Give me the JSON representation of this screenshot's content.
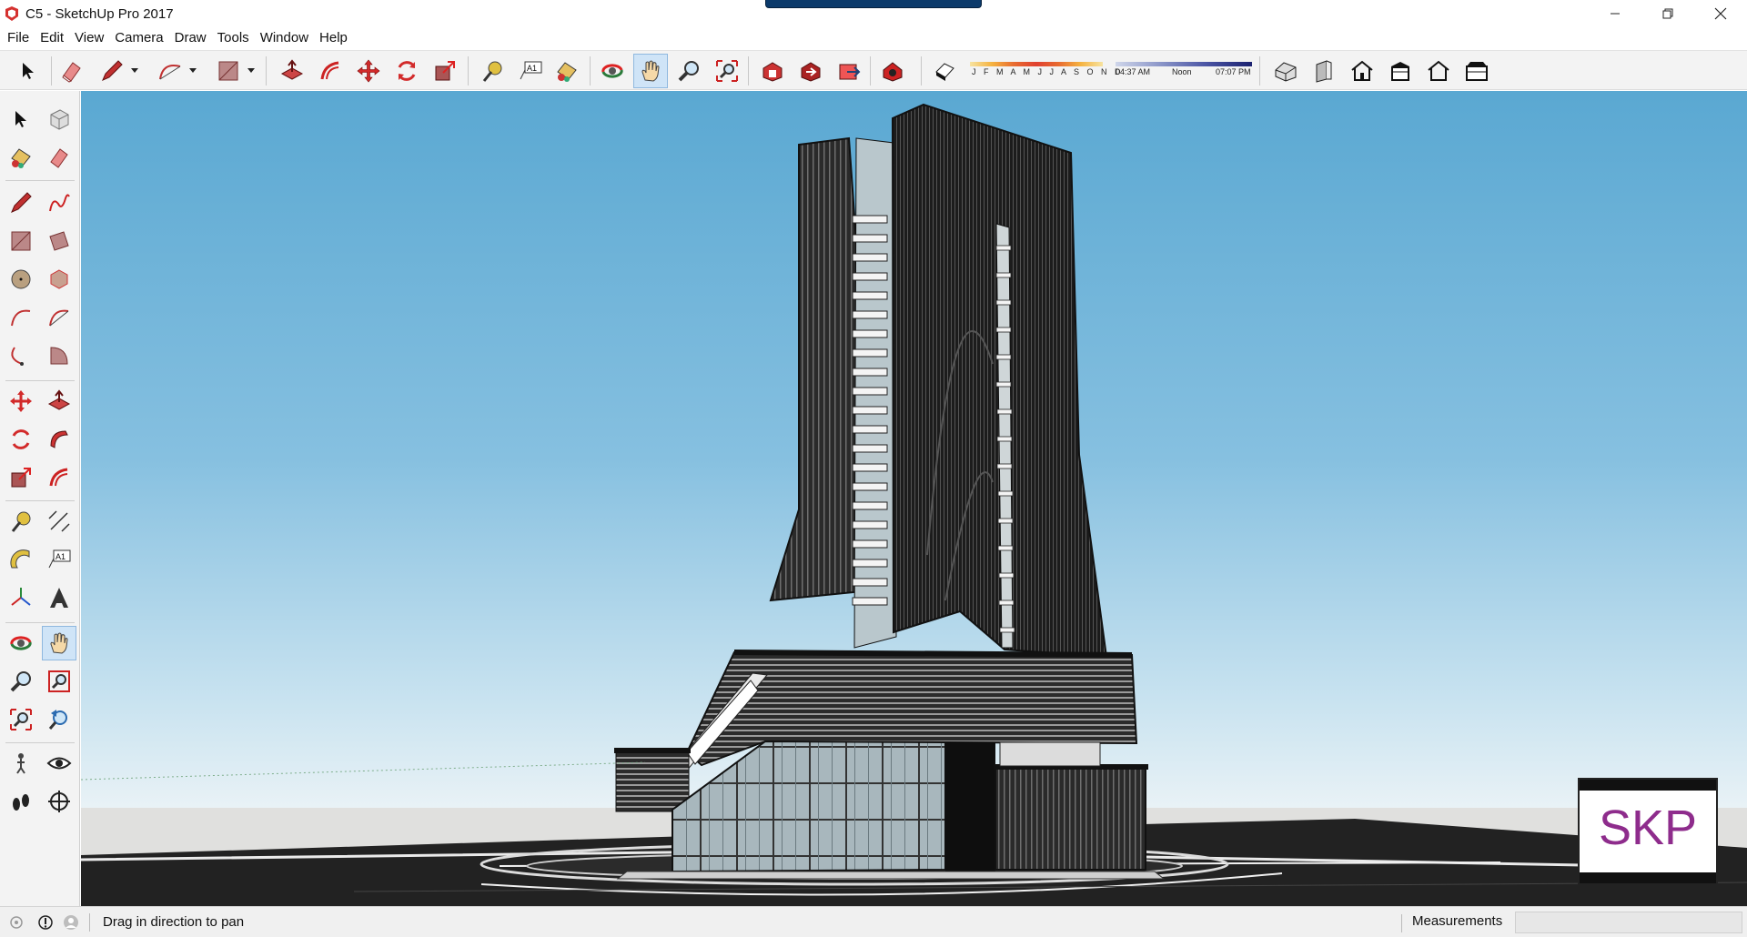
{
  "window": {
    "title": "C5 - SketchUp Pro 2017",
    "controls": [
      "minimize",
      "restore",
      "close"
    ]
  },
  "menu": [
    "File",
    "Edit",
    "View",
    "Camera",
    "Draw",
    "Tools",
    "Window",
    "Help"
  ],
  "toolbar": {
    "months_label": "J F M A M J J A S O N D",
    "time_start": "04:37 AM",
    "time_mid": "Noon",
    "time_end": "07:07 PM",
    "active_tool": "pan",
    "colors": {
      "active_bg": "#cfe4f7",
      "accent_red": "#d22a2a"
    }
  },
  "left_toolbar": {
    "active_tool": "pan"
  },
  "viewport": {
    "badge": "SKP",
    "badge_color": "#8e2c8c",
    "sky_color": "#5aa8d2"
  },
  "status": {
    "hint": "Drag in direction to pan",
    "measurements_label": "Measurements",
    "measurements_value": ""
  }
}
